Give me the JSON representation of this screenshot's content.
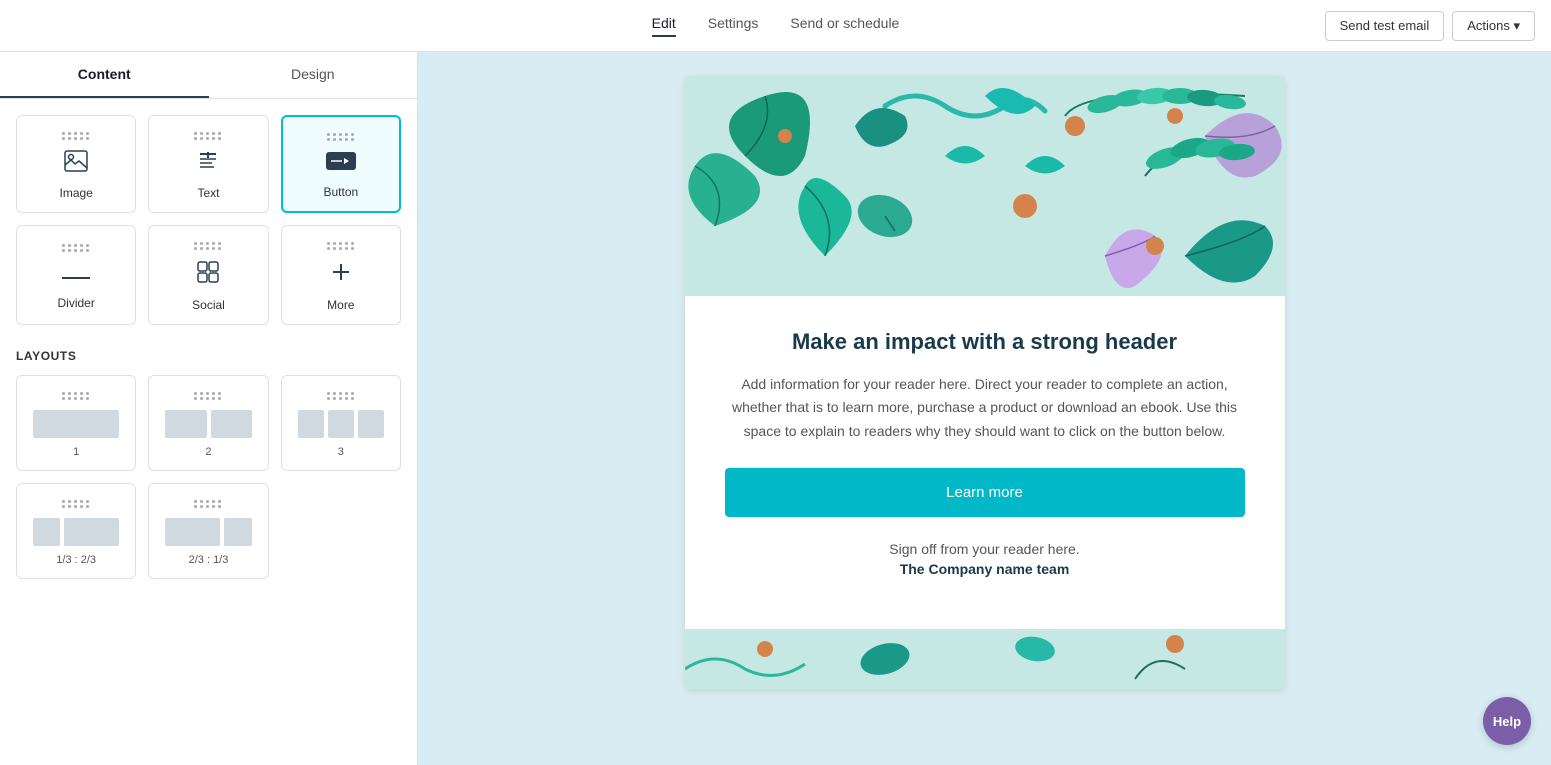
{
  "nav": {
    "tabs": [
      {
        "id": "edit",
        "label": "Edit",
        "active": true
      },
      {
        "id": "settings",
        "label": "Settings",
        "active": false
      },
      {
        "id": "send",
        "label": "Send or schedule",
        "active": false
      }
    ],
    "send_test_label": "Send test email",
    "actions_label": "Actions ▾"
  },
  "left_panel": {
    "tabs": [
      {
        "id": "content",
        "label": "Content",
        "active": true
      },
      {
        "id": "design",
        "label": "Design",
        "active": false
      }
    ],
    "content_blocks": [
      {
        "id": "image",
        "label": "Image",
        "icon": "🖼"
      },
      {
        "id": "text",
        "label": "Text",
        "icon": "≡"
      },
      {
        "id": "button",
        "label": "Button",
        "icon": "▬",
        "selected": true
      },
      {
        "id": "divider",
        "label": "Divider",
        "icon": "—"
      },
      {
        "id": "social",
        "label": "Social",
        "icon": "#"
      },
      {
        "id": "more",
        "label": "More",
        "icon": "+"
      }
    ],
    "layouts_title": "LAYOUTS",
    "layouts": [
      {
        "id": "l1",
        "label": "1",
        "cols": 1
      },
      {
        "id": "l2",
        "label": "2",
        "cols": 2
      },
      {
        "id": "l3",
        "label": "3",
        "cols": 3
      },
      {
        "id": "l4",
        "label": "1/3 : 2/3",
        "cols": "1/3-2/3"
      },
      {
        "id": "l5",
        "label": "2/3 : 1/3",
        "cols": "2/3-1/3"
      }
    ]
  },
  "email_preview": {
    "headline": "Make an impact with a strong header",
    "body_text": "Add information for your reader here. Direct your reader to complete an action, whether that is to learn more, purchase a product or download an ebook. Use this space to explain to readers why they should want to click on the button below.",
    "button_label": "Learn more",
    "signoff": "Sign off from your reader here.",
    "company": "The Company name team"
  },
  "help_label": "Help"
}
